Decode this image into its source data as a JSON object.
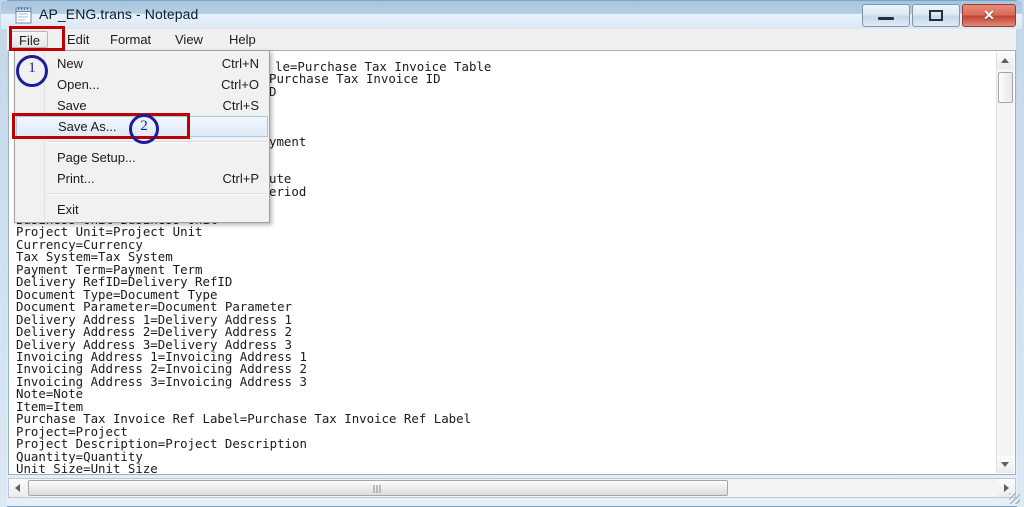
{
  "window": {
    "title": "AP_ENG.trans - Notepad",
    "icon": "notepad-icon",
    "controls": {
      "minimize_label": "—",
      "maximize_label": "❐",
      "close_label": "✕"
    }
  },
  "menubar": {
    "items": [
      {
        "label": "File",
        "active": true
      },
      {
        "label": "Edit",
        "active": false
      },
      {
        "label": "Format",
        "active": false
      },
      {
        "label": "View",
        "active": false
      },
      {
        "label": "Help",
        "active": false
      }
    ]
  },
  "file_menu": {
    "items": [
      {
        "label": "New",
        "accel": "Ctrl+N",
        "highlight": false
      },
      {
        "label": "Open...",
        "accel": "Ctrl+O",
        "highlight": false
      },
      {
        "label": "Save",
        "accel": "Ctrl+S",
        "highlight": false
      },
      {
        "label": "Save As...",
        "accel": "",
        "highlight": true
      },
      {
        "label": "Page Setup...",
        "accel": "",
        "highlight": false
      },
      {
        "label": "Print...",
        "accel": "Ctrl+P",
        "highlight": false
      },
      {
        "label": "Exit",
        "accel": "",
        "highlight": false
      }
    ]
  },
  "annotations": {
    "step_one": "1",
    "step_two": "2",
    "box_color": "#c00000",
    "circle_color": "#1d1d9c"
  },
  "editor": {
    "occluded_lines": [
      "le=Purchase Tax Invoice Table",
      "Purchase Tax Invoice ID",
      "D",
      "yment",
      "ute",
      "eriod"
    ],
    "visible_text": "Business Unit=Business Unit\nProject Unit=Project Unit\nCurrency=Currency\nTax System=Tax System\nPayment Term=Payment Term\nDelivery RefID=Delivery RefID\nDocument Type=Document Type\nDocument Parameter=Document Parameter\nDelivery Address 1=Delivery Address 1\nDelivery Address 2=Delivery Address 2\nDelivery Address 3=Delivery Address 3\nInvoicing Address 1=Invoicing Address 1\nInvoicing Address 2=Invoicing Address 2\nInvoicing Address 3=Invoicing Address 3\nNote=Note\nItem=Item\nPurchase Tax Invoice Ref Label=Purchase Tax Invoice Ref Label\nProject=Project\nProject Description=Project Description\nQuantity=Quantity\nUnit Size=Unit Size"
  },
  "scrollbars": {
    "vertical_position": "near-top",
    "horizontal_position": "left"
  }
}
